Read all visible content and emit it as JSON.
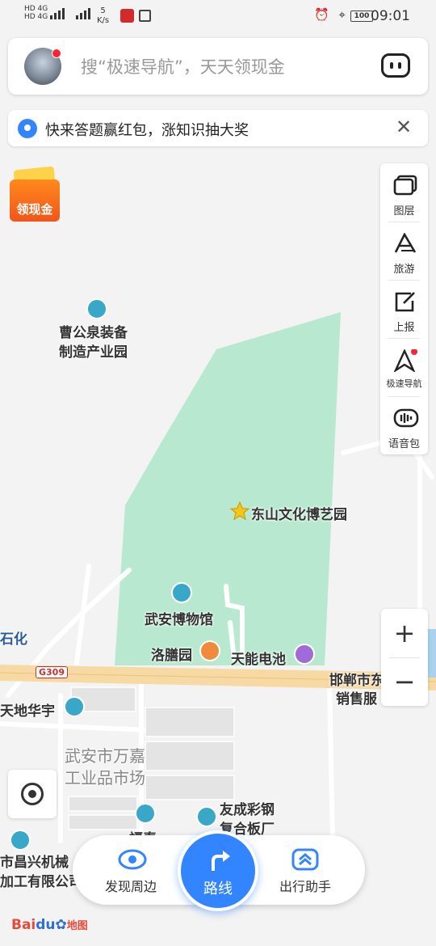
{
  "status_bar": {
    "net_line1": "HD 4G",
    "net_line2": "HD 4G",
    "speed_value": "5",
    "speed_unit": "K/s",
    "battery": "100",
    "time": "09:01"
  },
  "search": {
    "placeholder": "搜“极速导航”，天天领现金"
  },
  "notice": {
    "text": "快来答题赢红包，涨知识抽大奖",
    "close": "✕"
  },
  "red_packet": {
    "label": "领现金"
  },
  "toolbar": {
    "items": [
      {
        "label": "图层",
        "icon": "layers-icon"
      },
      {
        "label": "旅游",
        "icon": "travel-icon"
      },
      {
        "label": "上报",
        "icon": "report-icon"
      },
      {
        "label": "极速导航",
        "icon": "fast-nav-icon"
      },
      {
        "label": "语音包",
        "icon": "voice-pack-icon"
      }
    ]
  },
  "zoom": {
    "in": "+",
    "out": "−"
  },
  "map": {
    "labels": {
      "caogongquan": "曹公泉装备\n制造产业园",
      "dongshan": "东山文化博艺园",
      "museum": "武安博物馆",
      "luoshan": "洛膳园",
      "battery_shop": "天能电池",
      "shihua": "石化",
      "handan": "邯郸市东",
      "sales": "销售服",
      "tiandi": "天地华宇",
      "wanjia": "武安市万嘉\n工业品市场",
      "youcheng": "友成彩钢\n复合板厂",
      "changxing": "市昌兴机械\n加工有限公司",
      "cut_label": "福泰"
    },
    "road_shield": "G309",
    "colors": {
      "park": "#b8e8cf",
      "road_major": "#f6d9a3",
      "road_minor": "#ffffff",
      "background": "#f3f3f3"
    }
  },
  "bottom_nav": {
    "discover": "发现周边",
    "route": "路线",
    "assistant": "出行助手"
  },
  "branding": {
    "logo_a": "Bai",
    "logo_b": "du",
    "logo_c": "地图"
  }
}
